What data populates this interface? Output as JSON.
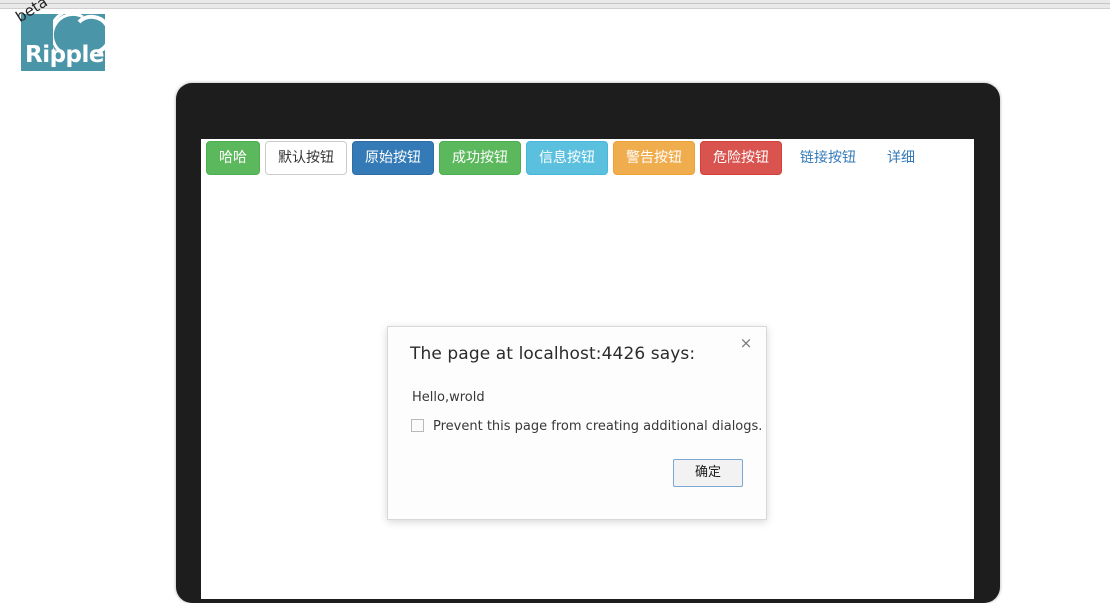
{
  "brand": {
    "name": "Ripple",
    "badge": "beta",
    "logo_bg": "#4a95a8",
    "logo_icon": "ripple-arcs-icon"
  },
  "toolbar": {
    "buttons": [
      {
        "label": "哈哈",
        "style": "haha",
        "name": "haha-button",
        "color": "#5cb85c"
      },
      {
        "label": "默认按钮",
        "style": "default",
        "name": "default-button",
        "color": "#ffffff"
      },
      {
        "label": "原始按钮",
        "style": "primary",
        "name": "primary-button",
        "color": "#337ab7"
      },
      {
        "label": "成功按钮",
        "style": "success",
        "name": "success-button",
        "color": "#5cb85c"
      },
      {
        "label": "信息按钮",
        "style": "info",
        "name": "info-button",
        "color": "#5bc0de"
      },
      {
        "label": "警告按钮",
        "style": "warning",
        "name": "warning-button",
        "color": "#f0ad4e"
      },
      {
        "label": "危险按钮",
        "style": "danger",
        "name": "danger-button",
        "color": "#d9534f"
      },
      {
        "label": "链接按钮",
        "style": "link",
        "name": "link-button",
        "color": "#337ab7"
      },
      {
        "label": "详细",
        "style": "link",
        "name": "detail-button",
        "color": "#337ab7"
      }
    ]
  },
  "dialog": {
    "title": "The page at localhost:4426 says:",
    "message": "Hello,wrold",
    "checkbox_label": "Prevent this page from creating additional dialogs.",
    "checkbox_checked": false,
    "ok_label": "确定",
    "close_icon": "×"
  }
}
